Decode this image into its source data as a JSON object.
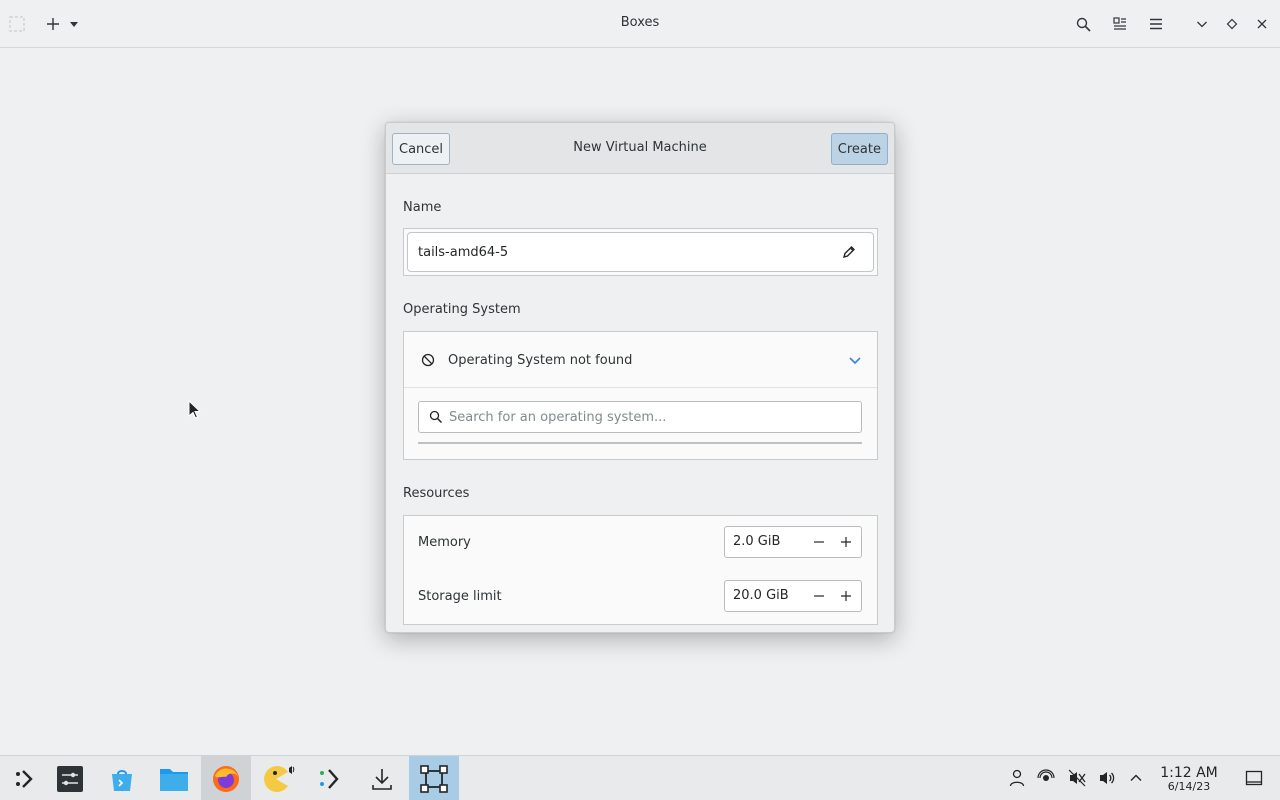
{
  "window": {
    "title": "Boxes"
  },
  "dialog": {
    "title": "New Virtual Machine",
    "cancel_label": "Cancel",
    "create_label": "Create",
    "name_section_label": "Name",
    "name_value": "tails-amd64-5",
    "os_section_label": "Operating System",
    "os_status": "Operating System not found",
    "os_search_placeholder": "Search for an operating system...",
    "resources_section_label": "Resources",
    "memory_label": "Memory",
    "memory_value": "2.0 GiB",
    "storage_label": "Storage limit",
    "storage_value": "20.0 GiB"
  },
  "taskbar": {
    "items": [
      "application-launcher-icon",
      "system-settings-icon",
      "discover-store-icon",
      "files-icon",
      "firefox-icon",
      "pacman-game-icon",
      "kdeconnect-icon",
      "downloads-icon",
      "boxes-icon"
    ],
    "clock_time": "1:12 AM",
    "clock_date": "6/14/23"
  },
  "colors": {
    "accent": "#a8cbe6",
    "create_button": "#bcd3e6",
    "link_blue": "#3584e4"
  }
}
